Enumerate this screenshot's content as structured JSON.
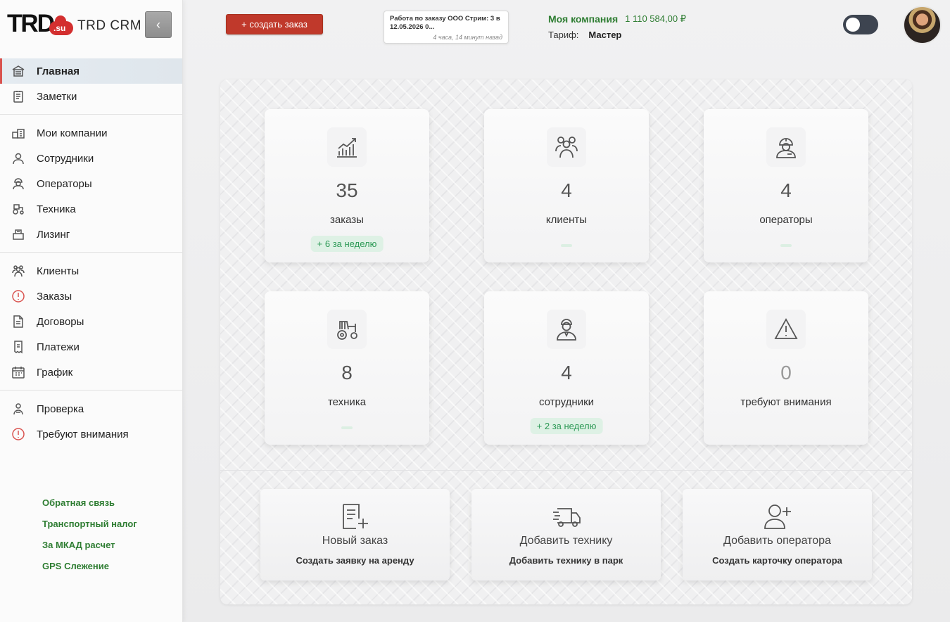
{
  "brand": {
    "logo_text": "TRD",
    "logo_suffix": ".su",
    "app_name": "TRD CRM",
    "accent": "#c0392b",
    "green": "#2e7d32"
  },
  "sidebar": {
    "collapse_icon": "chevron-left-icon",
    "items": [
      {
        "label": "Главная",
        "icon": "home-icon",
        "active": true
      },
      {
        "label": "Заметки",
        "icon": "notes-icon"
      },
      {
        "label": "Мои компании",
        "icon": "companies-icon"
      },
      {
        "label": "Сотрудники",
        "icon": "employee-icon"
      },
      {
        "label": "Операторы",
        "icon": "operator-icon"
      },
      {
        "label": "Техника",
        "icon": "tractor-icon"
      },
      {
        "label": "Лизинг",
        "icon": "leasing-icon"
      },
      {
        "label": "Клиенты",
        "icon": "clients-icon"
      },
      {
        "label": "Заказы",
        "icon": "alert-circle-icon"
      },
      {
        "label": "Договоры",
        "icon": "document-icon"
      },
      {
        "label": "Платежи",
        "icon": "receipt-icon"
      },
      {
        "label": "График",
        "icon": "calendar-icon"
      },
      {
        "label": "Проверка",
        "icon": "inspection-icon"
      },
      {
        "label": "Требуют внимания",
        "icon": "alert-circle-icon"
      }
    ],
    "links": [
      "Обратная связь",
      "Транспортный налог",
      "За МКАД расчет",
      "GPS Слежение"
    ]
  },
  "header": {
    "create_order_label": "+ создать заказ",
    "notification": {
      "text": "Работа по заказу ООО Стрим: 3 в 12.05.2026 0...",
      "time": "4 часа, 14 минут назад"
    },
    "company_label": "Моя компания",
    "company_balance": "1 110 584,00 ₽",
    "tariff_label": "Тариф:",
    "tariff_value": "Мастер"
  },
  "stats": [
    {
      "value": "35",
      "label": "заказы",
      "badge": "+ 6 за неделю",
      "icon": "chart-growth-icon"
    },
    {
      "value": "4",
      "label": "клиенты",
      "badge": "",
      "icon": "clients-icon"
    },
    {
      "value": "4",
      "label": "операторы",
      "badge": "",
      "icon": "operator-icon"
    },
    {
      "value": "8",
      "label": "техника",
      "badge": "",
      "icon": "tractor-icon"
    },
    {
      "value": "4",
      "label": "сотрудники",
      "badge": "+ 2 за неделю",
      "icon": "employee-icon"
    },
    {
      "value": "0",
      "label": "требуют внимания",
      "badge": null,
      "icon": "warning-triangle-icon"
    }
  ],
  "actions": [
    {
      "title": "Новый заказ",
      "subtitle": "Создать заявку на аренду",
      "icon": "new-order-icon"
    },
    {
      "title": "Добавить технику",
      "subtitle": "Добавить технику в парк",
      "icon": "truck-icon"
    },
    {
      "title": "Добавить оператора",
      "subtitle": "Создать карточку оператора",
      "icon": "add-user-icon"
    }
  ]
}
